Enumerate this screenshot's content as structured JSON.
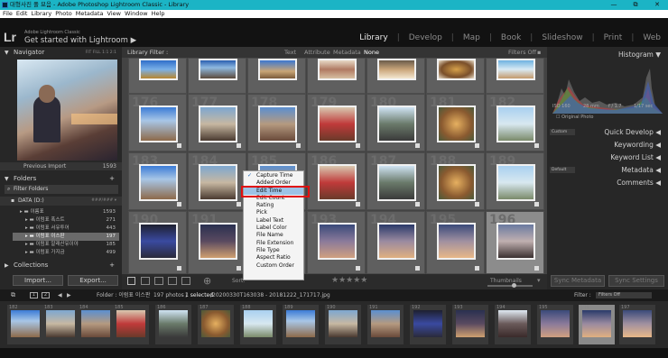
{
  "window": {
    "title": "대형사진 폴 묘음 - Adobe Photoshop Lightroom Classic - Library",
    "controls": [
      "—",
      "⧉",
      "✕"
    ]
  },
  "menu": [
    "File",
    "Edit",
    "Library",
    "Photo",
    "Metadata",
    "View",
    "Window",
    "Help"
  ],
  "identity": {
    "logo": "Lr",
    "sub": "Adobe Lightroom Classic",
    "main": "Get started with Lightroom",
    "arrow": "▶"
  },
  "modules": [
    {
      "label": "Library",
      "active": true
    },
    {
      "label": "Develop",
      "active": false
    },
    {
      "label": "Map",
      "active": false
    },
    {
      "label": "Book",
      "active": false
    },
    {
      "label": "Slideshow",
      "active": false
    },
    {
      "label": "Print",
      "active": false
    },
    {
      "label": "Web",
      "active": false
    }
  ],
  "left": {
    "navigator": {
      "title": "Navigator",
      "zoom": "FIT FILL 1:1 2:1"
    },
    "previous_import": {
      "label": "Previous Import",
      "count": "1593"
    },
    "folders": {
      "title": "Folders",
      "filter": "Filter Folders",
      "volume": "DATA (D:)",
      "volume_info": "###/### ▾"
    },
    "folder_rows": [
      {
        "name": "이름표",
        "count": "1593"
      },
      {
        "name": "이럼표 폭스트",
        "count": "271"
      },
      {
        "name": "이럼표 서유투어",
        "count": "443"
      },
      {
        "name": "이럼표 이스판",
        "count": "197",
        "selected": true
      },
      {
        "name": "이럼표 알래산유이야",
        "count": "185"
      },
      {
        "name": "이럼표 가지금",
        "count": "499"
      }
    ],
    "collections": {
      "title": "Collections"
    },
    "import_label": "Import...",
    "export_label": "Export..."
  },
  "filterbar": {
    "title": "Library Filter :",
    "tabs": [
      "Text",
      "Attribute",
      "Metadata",
      "None"
    ],
    "status": "Filters Off"
  },
  "grid_numbers": [
    "176",
    "177",
    "178",
    "179",
    "180",
    "181",
    "182",
    "183",
    "184",
    "185",
    "186",
    "187",
    "188",
    "189",
    "190",
    "191",
    "192",
    "193",
    "194",
    "195",
    "196"
  ],
  "context_menu": {
    "items": [
      {
        "label": "Capture Time",
        "checked": true
      },
      {
        "label": "Added Order"
      },
      {
        "label": "Edit Time",
        "highlighted": true
      },
      {
        "label": "Edit Count"
      },
      {
        "label": "Rating"
      },
      {
        "label": "Pick"
      },
      {
        "label": "Label Text"
      },
      {
        "label": "Label Color"
      },
      {
        "label": "File Name"
      },
      {
        "label": "File Extension"
      },
      {
        "label": "File Type"
      },
      {
        "label": "Aspect Ratio"
      },
      {
        "label": "Custom Order"
      }
    ]
  },
  "toolbar": {
    "sort_label": "Sort:",
    "thumbnails_label": "Thumbnails"
  },
  "right": {
    "histogram": {
      "title": "Histogram",
      "iso": "ISO 160",
      "focal": "28 mm",
      "aperture": "f / 1.7",
      "shutter": "1/17 sec",
      "original": "Original Photo"
    },
    "quick_develop": {
      "preset": "Custom",
      "label": "Quick Develop"
    },
    "keywording": "Keywording",
    "keyword_list": "Keyword List",
    "metadata": {
      "preset": "Default",
      "label": "Metadata"
    },
    "comments": "Comments",
    "sync_metadata": "Sync Metadata",
    "sync_settings": "Sync Settings"
  },
  "status": {
    "pages": [
      "1",
      "2"
    ],
    "path": "Folder : 이럼표 이스판",
    "photo_count": "197 photos /",
    "selected": "1 selected",
    "filename": "/20200330T163038 - 20181222_171717.jpg",
    "filter_label": "Filter :",
    "filter_value": "Filters Off"
  },
  "film_numbers": [
    "182",
    "183",
    "184",
    "185",
    "186",
    "187",
    "188",
    "189",
    "190",
    "191",
    "192",
    "193",
    "194",
    "195",
    "196",
    "197"
  ],
  "colors": {
    "accent": "#1bb4c5",
    "highlight_box": "#e01010",
    "menu_highlight": "#9cc3e6"
  }
}
